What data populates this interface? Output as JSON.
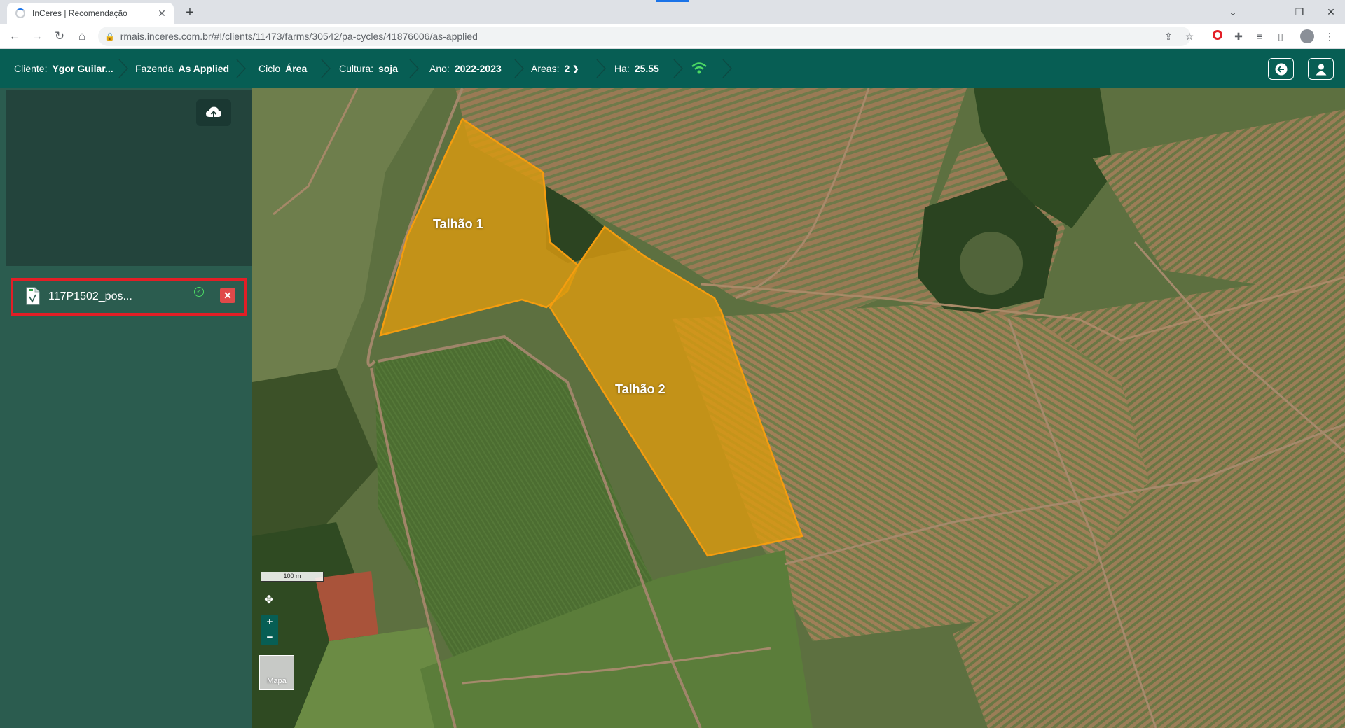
{
  "browser": {
    "tab_title": "InCeres | Recomendação",
    "tab_close": "✕",
    "new_tab": "+",
    "url": "rmais.inceres.com.br/#!/clients/11473/farms/30542/pa-cycles/41876006/as-applied"
  },
  "header": {
    "cliente_label": "Cliente:",
    "cliente_value": "Ygor Guilar...",
    "fazenda_label": "Fazenda",
    "fazenda_value": "As Applied",
    "ciclo_label": "Ciclo",
    "ciclo_value": "Área",
    "cultura_label": "Cultura:",
    "cultura_value": "soja",
    "ano_label": "Ano:",
    "ano_value": "2022-2023",
    "areas_label": "Áreas:",
    "areas_value": "2",
    "ha_label": "Ha:",
    "ha_value": "25.55",
    "colors": {
      "bar": "#075e54",
      "wifi": "#4cd964"
    }
  },
  "sidebar": {
    "file_name": "117P1502_pos..."
  },
  "map": {
    "field1_label": "Talhão 1",
    "field2_label": "Talhão 2",
    "scale_label": "100 m",
    "zoom_in": "+",
    "zoom_out": "−",
    "layer_label": "Mapa",
    "field_fill": "#d99a10",
    "field_stroke": "#f59d0f"
  }
}
